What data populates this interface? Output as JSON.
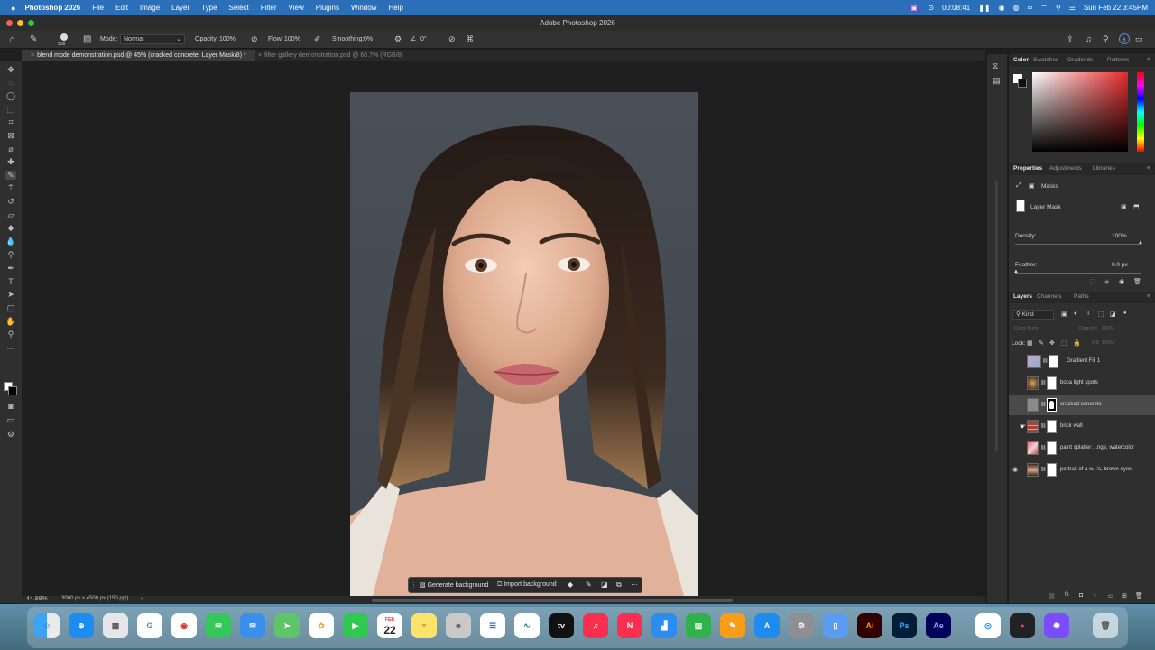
{
  "menubar": {
    "app_name": "Photoshop 2026",
    "items": [
      "File",
      "Edit",
      "Image",
      "Layer",
      "Type",
      "Select",
      "Filter",
      "View",
      "Plugins",
      "Window",
      "Help"
    ],
    "timer": "00:08:41",
    "datetime": "Sun Feb 22  3:45PM"
  },
  "window": {
    "title": "Adobe Photoshop 2026"
  },
  "options_bar": {
    "brush_size": "508",
    "mode_label": "Mode:",
    "mode_value": "Normal",
    "opacity_label": "Opacity:",
    "opacity_value": "100%",
    "flow_label": "Flow:",
    "flow_value": "100%",
    "smoothing_label": "Smoothing:",
    "smoothing_value": "0%",
    "angle_value": "0°"
  },
  "doc_tabs": [
    {
      "label": "blend mode demonstration.psd @ 45% (cracked concrete, Layer Mask/8) *",
      "active": true
    },
    {
      "label": "filter gallery demonstration.psd @ 66.7% (RGB/8)",
      "active": false
    }
  ],
  "status_bar": {
    "zoom": "44.98%",
    "doc_info": "3000 px x 4500 px (150 ppi)"
  },
  "contextual_bar": {
    "generate_label": "Generate background",
    "import_label": "Import background"
  },
  "color_panel": {
    "tabs": [
      "Color",
      "Swatches",
      "Gradients",
      "Patterns"
    ]
  },
  "properties_panel": {
    "tabs": [
      "Properties",
      "Adjustments",
      "Libraries"
    ],
    "section": "Masks",
    "mask_type": "Layer Mask",
    "density_label": "Density:",
    "density_value": "100%",
    "feather_label": "Feather:",
    "feather_value": "0.0 px"
  },
  "layers_panel": {
    "tabs": [
      "Layers",
      "Channels",
      "Paths"
    ],
    "filter_kind": "Kind",
    "blend_mode": "Color Burn",
    "opacity_label": "Opacity:",
    "opacity_value": "100%",
    "lock_label": "Lock:",
    "fill_label": "Fill:",
    "fill_value": "100%",
    "layers": [
      {
        "name": "Gradient Fill 1",
        "visible": false,
        "selected": false
      },
      {
        "name": "boca light spots",
        "visible": false,
        "selected": false
      },
      {
        "name": "cracked concrete",
        "visible": false,
        "selected": true
      },
      {
        "name": "brick wall",
        "visible": false,
        "selected": false
      },
      {
        "name": "paint splatter ...nge, watercolor",
        "visible": false,
        "selected": false
      },
      {
        "name": "portrait of a w...'s, brown eyes",
        "visible": true,
        "selected": false
      }
    ]
  },
  "dock": {
    "calendar_month": "FEB",
    "calendar_day": "22",
    "apps": [
      "Finder",
      "Safari",
      "Launchpad",
      "Google",
      "Chrome",
      "Messages",
      "Mail",
      "Maps",
      "Photos",
      "FaceTime",
      "Calendar",
      "Notes",
      "Contacts",
      "Reminders",
      "Freeform",
      "TV",
      "Music",
      "News",
      "Keynote",
      "Numbers",
      "Pages",
      "App Store",
      "System Settings",
      "Preview",
      "Illustrator",
      "Photoshop",
      "After Effects",
      "Screen Capture",
      "Recorder",
      "Perplexity",
      "Trash"
    ]
  },
  "colors": {
    "menubar": "#2b6fb8",
    "panel_bg": "#2f2f2f",
    "canvas_bg": "#1f1f1f"
  }
}
